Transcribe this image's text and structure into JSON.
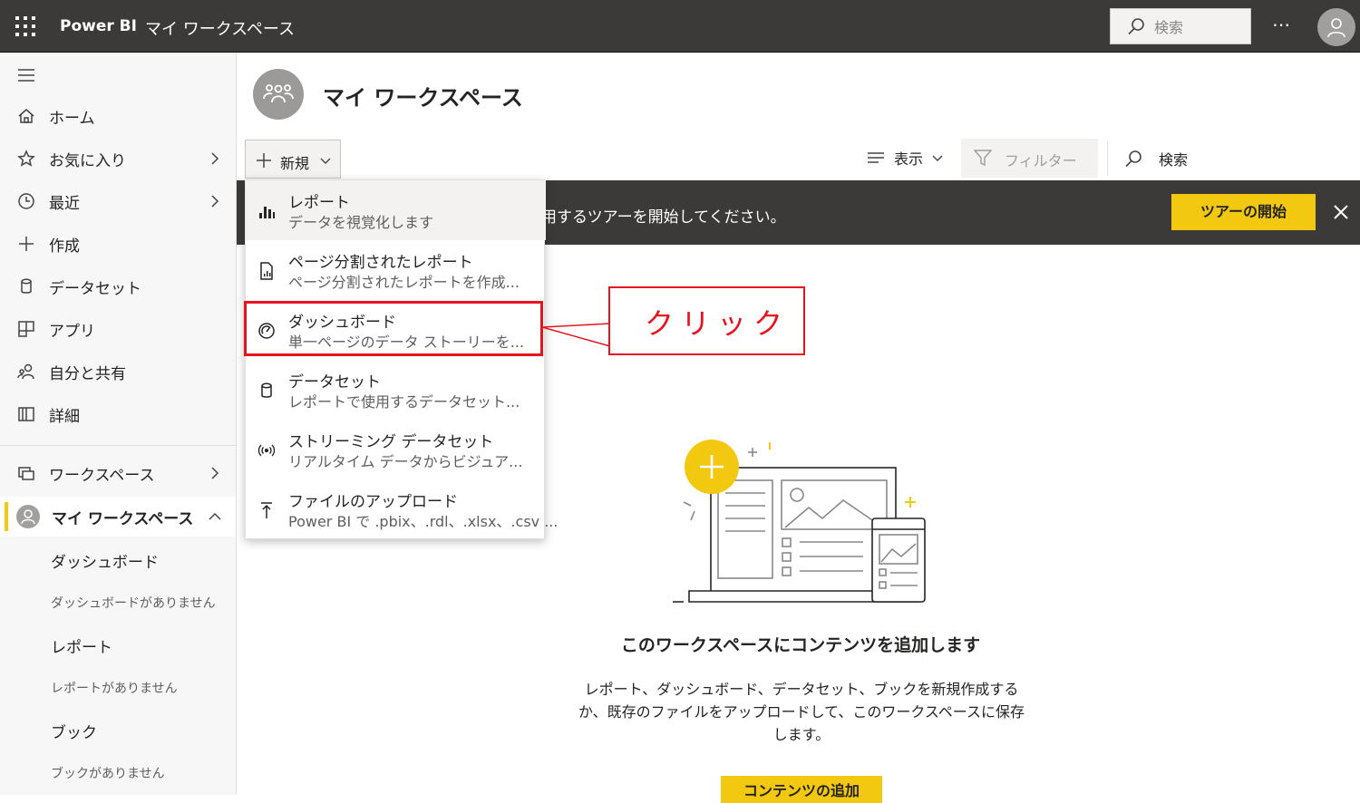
{
  "topbar": {
    "brand": "Power BI",
    "workspace_crumb": "マイ ワークスペース",
    "search_placeholder": "検索",
    "more_label": "⋯"
  },
  "sidebar": {
    "items": [
      {
        "label": "ホーム",
        "icon": "home-icon"
      },
      {
        "label": "お気に入り",
        "icon": "star-icon"
      },
      {
        "label": "最近",
        "icon": "clock-icon"
      },
      {
        "label": "作成",
        "icon": "plus-icon"
      },
      {
        "label": "データセット",
        "icon": "database-icon"
      },
      {
        "label": "アプリ",
        "icon": "apps-icon"
      },
      {
        "label": "自分と共有",
        "icon": "shared-icon"
      },
      {
        "label": "詳細",
        "icon": "book-icon"
      },
      {
        "label": "ワークスペース",
        "icon": "workspaces-icon"
      },
      {
        "label": "マイ ワークスペース",
        "icon": "user-icon"
      }
    ],
    "sub": {
      "dashboards": "ダッシュボード",
      "no_dashboards": "ダッシュボードがありません",
      "reports": "レポート",
      "no_reports": "レポートがありません",
      "books": "ブック",
      "no_books": "ブックがありません"
    }
  },
  "main": {
    "title": "マイ ワークスペース",
    "new_label": "新規",
    "view_label": "表示",
    "filter_label": "フィルター",
    "search_label": "検索",
    "banner_text": "用するツアーを開始してください。",
    "tour_button": "ツアーの開始",
    "empty_title": "このワークスペースにコンテンツを追加します",
    "empty_desc": "レポート、ダッシュボード、データセット、ブックを新規作成するか、既存のファイルをアップロードして、このワークスペースに保存します。",
    "add_button": "コンテンツの追加"
  },
  "menu": {
    "items": [
      {
        "title": "レポート",
        "desc": "データを視覚化します",
        "icon": "bar-chart-icon"
      },
      {
        "title": "ページ分割されたレポート",
        "desc": "ページ分割されたレポートを作成...",
        "icon": "paginated-report-icon"
      },
      {
        "title": "ダッシュボード",
        "desc": "単一ページのデータ ストーリーを...",
        "icon": "dashboard-gauge-icon"
      },
      {
        "title": "データセット",
        "desc": "レポートで使用するデータセット...",
        "icon": "database-icon"
      },
      {
        "title": "ストリーミング データセット",
        "desc": "リアルタイム データからビジュア...",
        "icon": "streaming-icon"
      },
      {
        "title": "ファイルのアップロード",
        "desc": "Power BI で .pbix、.rdl、.xlsx、.csv ...",
        "icon": "upload-icon"
      }
    ]
  },
  "annotation": {
    "callout_text": "クリック",
    "color": "#e8131e"
  },
  "colors": {
    "accent": "#f2c811",
    "topbar": "#3b3a39"
  }
}
